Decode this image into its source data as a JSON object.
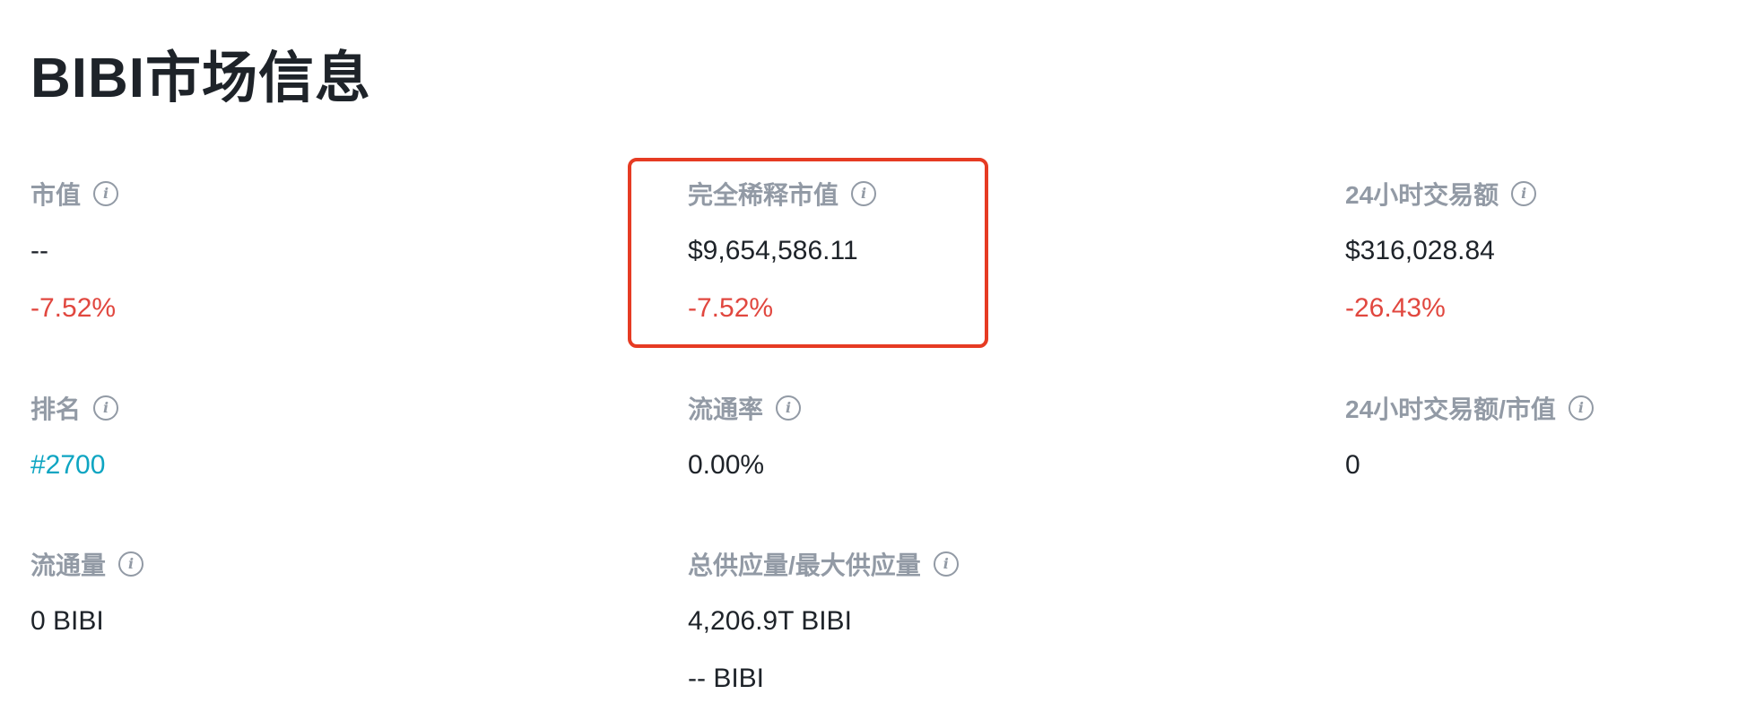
{
  "title": "BIBI市场信息",
  "metrics": {
    "market_cap": {
      "label": "市值",
      "value": "--",
      "change": "-7.52%"
    },
    "fdv": {
      "label": "完全稀释市值",
      "value": "$9,654,586.11",
      "change": "-7.52%"
    },
    "volume_24h": {
      "label": "24小时交易额",
      "value": "$316,028.84",
      "change": "-26.43%"
    },
    "rank": {
      "label": "排名",
      "value": "#2700"
    },
    "circulation_rate": {
      "label": "流通率",
      "value": "0.00%"
    },
    "volume_to_mcap": {
      "label": "24小时交易额/市值",
      "value": "0"
    },
    "circulating_supply": {
      "label": "流通量",
      "value": "0 BIBI"
    },
    "supply": {
      "label": "总供应量/最大供应量",
      "total": "4,206.9T BIBI",
      "max": "-- BIBI"
    }
  },
  "info_icon_glyph": "i",
  "colors": {
    "negative": "#e1473f",
    "link": "#0ea5c2",
    "label": "#929aa5",
    "highlight": "#e63b23"
  }
}
